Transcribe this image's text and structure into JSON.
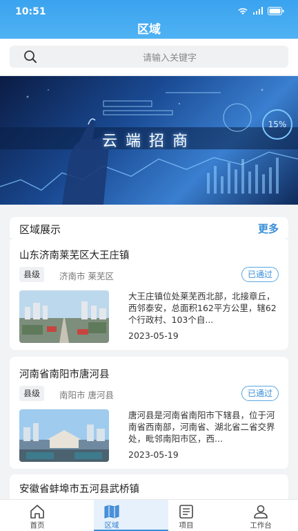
{
  "status_bar": {
    "time": "10:51"
  },
  "header": {
    "title": "区域"
  },
  "search": {
    "placeholder": "请输入关键字"
  },
  "banner": {
    "caption": "云端招商",
    "percent": "15%"
  },
  "section": {
    "title": "区域展示",
    "more_label": "更多"
  },
  "cards": [
    {
      "title": "山东济南莱芜区大王庄镇",
      "level": "县级",
      "location": "济南市 莱芜区",
      "status": "已通过",
      "description": "大王庄镇位处莱芜西北部，北接章丘，西邻泰安，总面积162平方公里，辖62个行政村、103个自...",
      "date": "2023-05-19"
    },
    {
      "title": "河南省南阳市唐河县",
      "level": "县级",
      "location": "南阳市 唐河县",
      "status": "已通过",
      "description": "唐河县是河南省南阳市下辖县，位于河南省西南部，河南省、湖北省二省交界处，毗邻南阳市区，西...",
      "date": "2023-05-19"
    },
    {
      "title": "安徽省蚌埠市五河县武桥镇"
    }
  ],
  "tabbar": {
    "items": [
      {
        "label": "首页",
        "icon": "home-icon"
      },
      {
        "label": "区域",
        "icon": "map-icon"
      },
      {
        "label": "项目",
        "icon": "list-icon"
      },
      {
        "label": "工作台",
        "icon": "user-icon"
      }
    ],
    "active_index": 1
  },
  "colors": {
    "primary": "#3a8fd8",
    "header": "#4fb2f3"
  }
}
